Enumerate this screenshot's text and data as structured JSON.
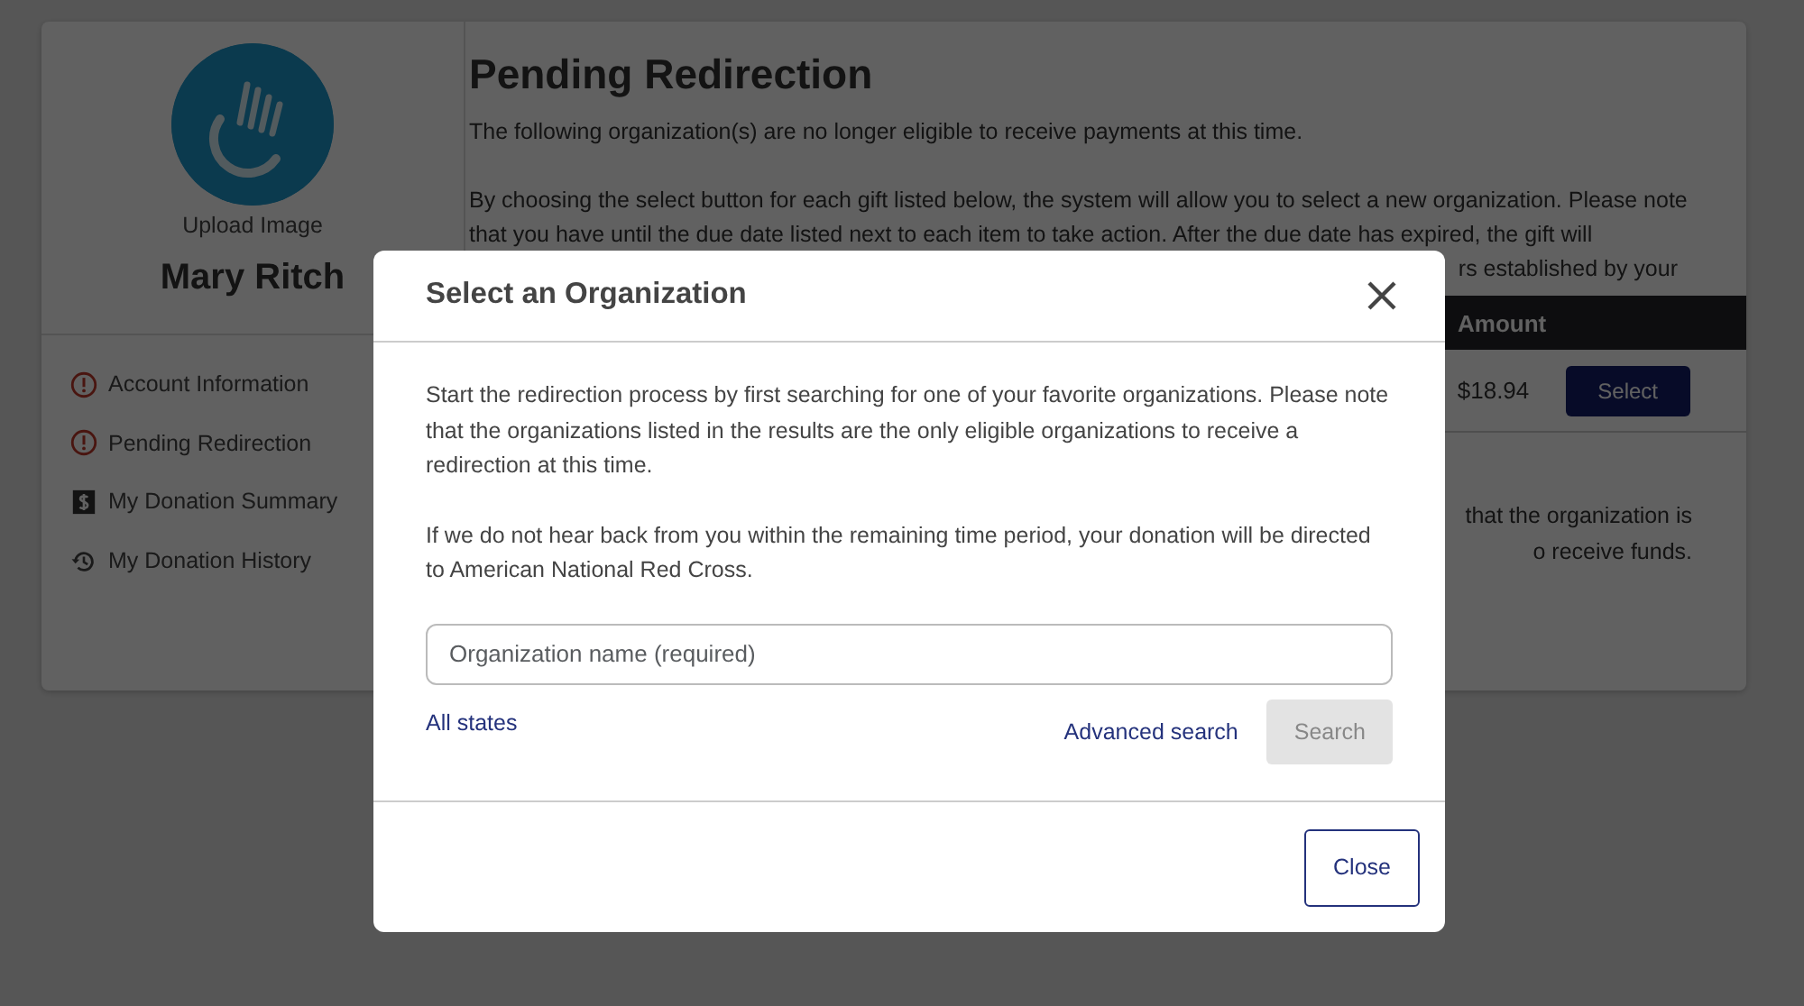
{
  "profile": {
    "upload_label": "Upload Image",
    "name": "Mary Ritch"
  },
  "sidebar": {
    "items": [
      {
        "kind": "alert",
        "label": "Account Information"
      },
      {
        "kind": "alert",
        "label": "Pending Redirection"
      },
      {
        "kind": "summary",
        "label": "My Donation Summary"
      },
      {
        "kind": "history",
        "label": "My Donation History"
      }
    ]
  },
  "page": {
    "title": "Pending Redirection",
    "intro": "The following organization(s) are no longer eligible to receive payments at this time.",
    "paragraph": "By choosing the select button for each gift listed below, the system will allow you to select a new organization. Please note that you have until the due date listed next to each item to take action. After the due date has expired, the gift will",
    "paragraph_fragment": "rs established by your",
    "table": {
      "columns": [
        "Amount"
      ],
      "rows": [
        {
          "amount": "$18.94",
          "action": "Select"
        }
      ]
    },
    "note_fragments": [
      "that the organization is",
      "o receive funds."
    ]
  },
  "modal": {
    "title": "Select an Organization",
    "paragraphs": [
      "Start the redirection process by first searching for one of your favorite organizations. Please note that the organizations listed in the results are the only eligible organizations to receive a redirection at this time.",
      "If we do not hear back from you within the remaining time period, your donation will be directed to American National Red Cross."
    ],
    "search": {
      "placeholder": "Organization name (required)"
    },
    "states_link": "All states",
    "advanced_link": "Advanced search",
    "search_button": {
      "label": "Search",
      "disabled": true
    },
    "close_button": "Close"
  }
}
